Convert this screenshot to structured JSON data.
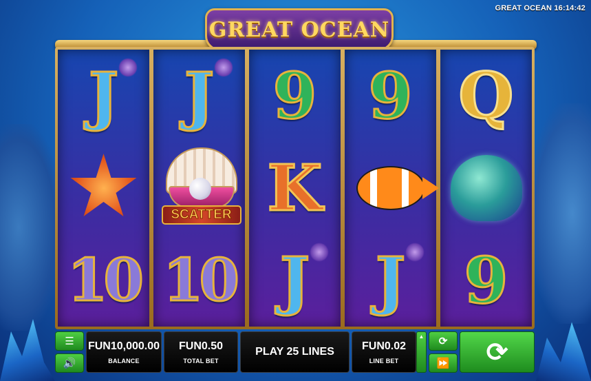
{
  "header": {
    "clock_text": "GREAT OCEAN 16:14:42",
    "logo_text": "GREAT OCEAN"
  },
  "reels": [
    {
      "symbols": [
        {
          "name": "j",
          "text": "J"
        },
        {
          "name": "starfish",
          "text": ""
        },
        {
          "name": "ten",
          "text": "10"
        }
      ]
    },
    {
      "symbols": [
        {
          "name": "j",
          "text": "J"
        },
        {
          "name": "scatter",
          "text": "SCATTER"
        },
        {
          "name": "ten",
          "text": "10"
        }
      ]
    },
    {
      "symbols": [
        {
          "name": "nine",
          "text": "9"
        },
        {
          "name": "k",
          "text": "K"
        },
        {
          "name": "j",
          "text": "J"
        }
      ]
    },
    {
      "symbols": [
        {
          "name": "nine",
          "text": "9"
        },
        {
          "name": "clownfish",
          "text": ""
        },
        {
          "name": "j",
          "text": "J"
        }
      ]
    },
    {
      "symbols": [
        {
          "name": "q",
          "text": "Q"
        },
        {
          "name": "octopus",
          "text": ""
        },
        {
          "name": "nine",
          "text": "9"
        }
      ]
    }
  ],
  "controls": {
    "balance_value": "FUN10,000.00",
    "balance_label": "BALANCE",
    "total_bet_value": "FUN0.50",
    "total_bet_label": "TOTAL BET",
    "lines_text": "PLAY 25 LINES",
    "line_bet_value": "FUN0.02",
    "line_bet_label": "LINE BET",
    "icons": {
      "menu": "menu-icon",
      "sound": "sound-icon",
      "autoplay": "autoplay-icon",
      "turbo": "fast-forward-icon",
      "spin": "spin-icon"
    }
  },
  "colors": {
    "button_green": "#2fa82a",
    "panel_black": "#000000",
    "frame_gold": "#d8b060"
  }
}
